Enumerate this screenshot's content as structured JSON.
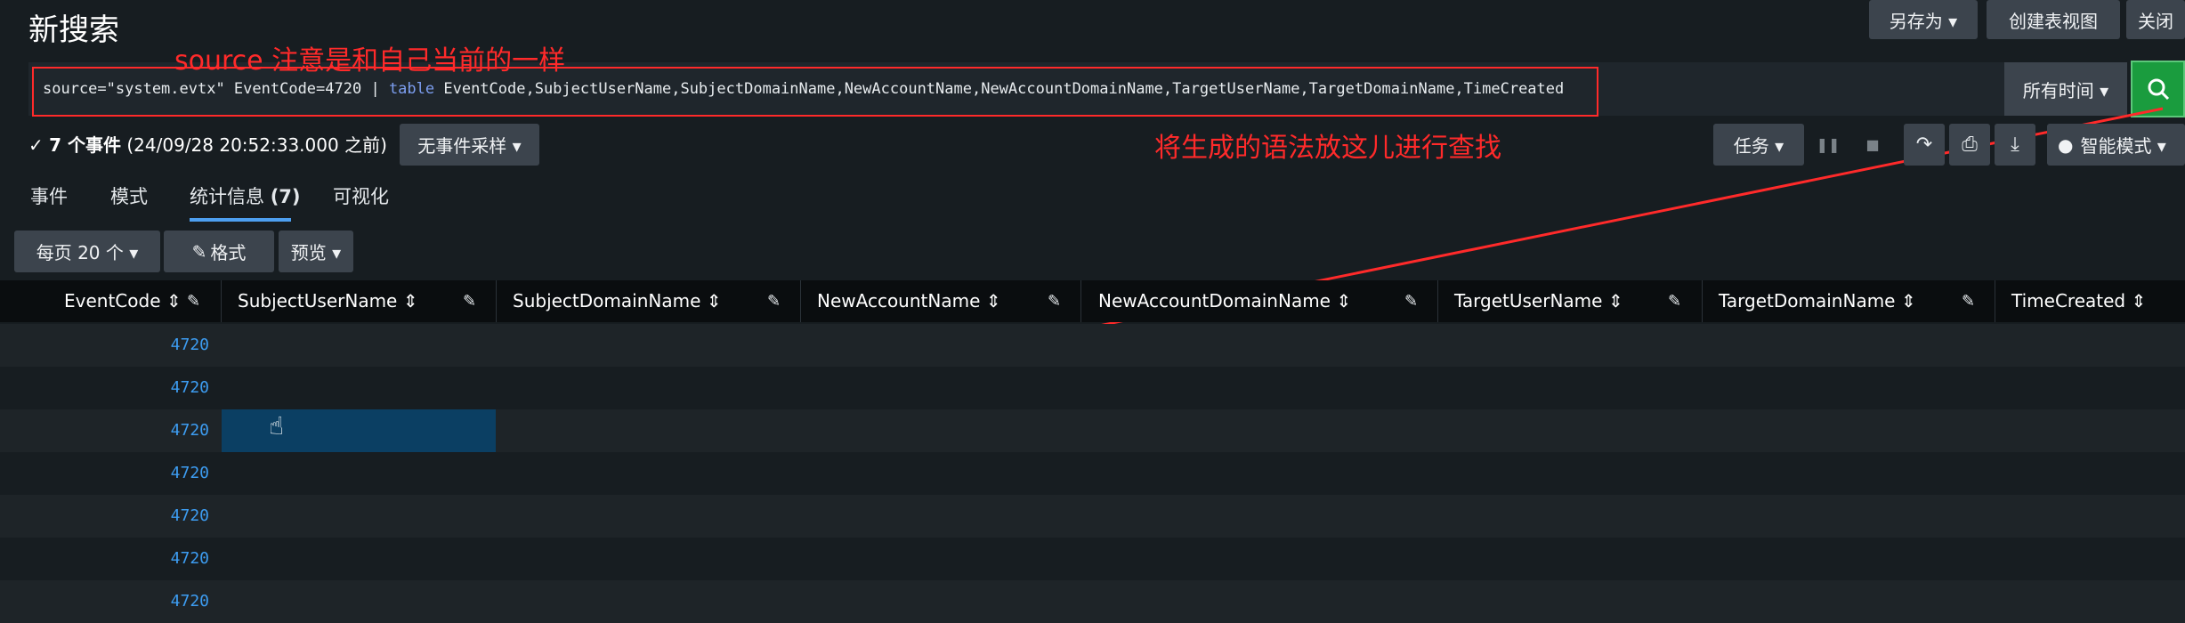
{
  "header": {
    "title": "新搜索",
    "save_as_label": "另存为 ▾",
    "create_table_view_label": "创建表视图",
    "close_label": "关闭"
  },
  "search": {
    "query_prefix": "source=\"system.evtx\" EventCode=4720 | ",
    "query_command": "table",
    "query_fields": " EventCode,SubjectUserName,SubjectDomainName,NewAccountName,NewAccountDomainName,TargetUserName,TargetDomainName,TimeCreated",
    "time_range_label": "所有时间 ▾"
  },
  "annotations": {
    "source_note": "source 注意是和自己当前的一样",
    "search_note": "将生成的语法放这儿进行查找"
  },
  "status": {
    "count_label": "7 个事件",
    "time_text": " (24/09/28 20:52:33.000 之前)",
    "sampling_label": "无事件采样 ▾",
    "job_label": "任务 ▾",
    "smart_mode_label": "智能模式 ▾"
  },
  "tabs": [
    {
      "label": "事件"
    },
    {
      "label": "模式"
    },
    {
      "label": "统计信息",
      "count": "(7)"
    },
    {
      "label": "可视化"
    }
  ],
  "table_options": {
    "per_page_label": "每页 20 个 ▾",
    "format_label": "格式",
    "preview_label": "预览 ▾"
  },
  "table": {
    "columns": [
      "EventCode",
      "SubjectUserName",
      "SubjectDomainName",
      "NewAccountName",
      "NewAccountDomainName",
      "TargetUserName",
      "TargetDomainName",
      "TimeCreated"
    ],
    "sort_icon": "⇕",
    "rows": [
      {
        "EventCode": "4720"
      },
      {
        "EventCode": "4720"
      },
      {
        "EventCode": "4720"
      },
      {
        "EventCode": "4720"
      },
      {
        "EventCode": "4720"
      },
      {
        "EventCode": "4720"
      },
      {
        "EventCode": "4720"
      }
    ]
  },
  "colors": {
    "accent": "#4d9ff0",
    "search_button": "#1a9c3e",
    "annotation": "#ff2a2a",
    "selected_cell": "#0b3f63"
  }
}
